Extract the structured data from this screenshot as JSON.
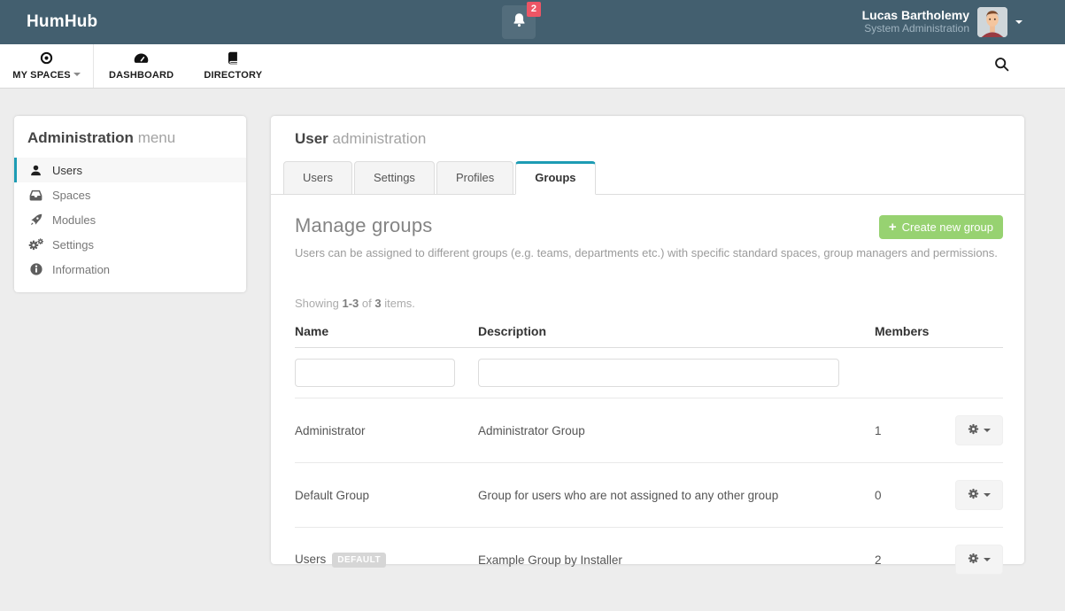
{
  "colors": {
    "topbar_bg": "#435f6f",
    "accent_teal": "#1d9cb4",
    "success_green": "#97d271",
    "badge_red": "#ed5565",
    "page_bg": "#ededed"
  },
  "topbar": {
    "brand": "HumHub",
    "notification_count": "2",
    "user": {
      "name": "Lucas Bartholemy",
      "role": "System Administration"
    }
  },
  "navbar": {
    "items": [
      {
        "label": "MY SPACES"
      },
      {
        "label": "DASHBOARD"
      },
      {
        "label": "DIRECTORY"
      }
    ]
  },
  "sidebar": {
    "title": "Administration",
    "title_suffix": "menu",
    "items": [
      {
        "label": "Users"
      },
      {
        "label": "Spaces"
      },
      {
        "label": "Modules"
      },
      {
        "label": "Settings"
      },
      {
        "label": "Information"
      }
    ]
  },
  "main": {
    "title": "User",
    "title_suffix": "administration",
    "tabs": [
      {
        "label": "Users"
      },
      {
        "label": "Settings"
      },
      {
        "label": "Profiles"
      },
      {
        "label": "Groups"
      }
    ],
    "heading": "Manage groups",
    "create_button": {
      "icon": "+",
      "label": "Create new group"
    },
    "description": "Users can be assigned to different groups (e.g. teams, departments etc.) with specific standard spaces, group managers and permissions.",
    "summary": {
      "showing": "Showing",
      "range": "1-3",
      "of": "of",
      "total": "3",
      "items": "items."
    },
    "table": {
      "columns": [
        "Name",
        "Description",
        "Members"
      ],
      "filters": {
        "name_value": "",
        "description_value": ""
      },
      "rows": [
        {
          "name": "Administrator",
          "badge": "",
          "description": "Administrator Group",
          "members": "1"
        },
        {
          "name": "Default Group",
          "badge": "",
          "description": "Group for users who are not assigned to any other group",
          "members": "0"
        },
        {
          "name": "Users",
          "badge": "DEFAULT",
          "description": "Example Group by Installer",
          "members": "2"
        }
      ]
    }
  }
}
